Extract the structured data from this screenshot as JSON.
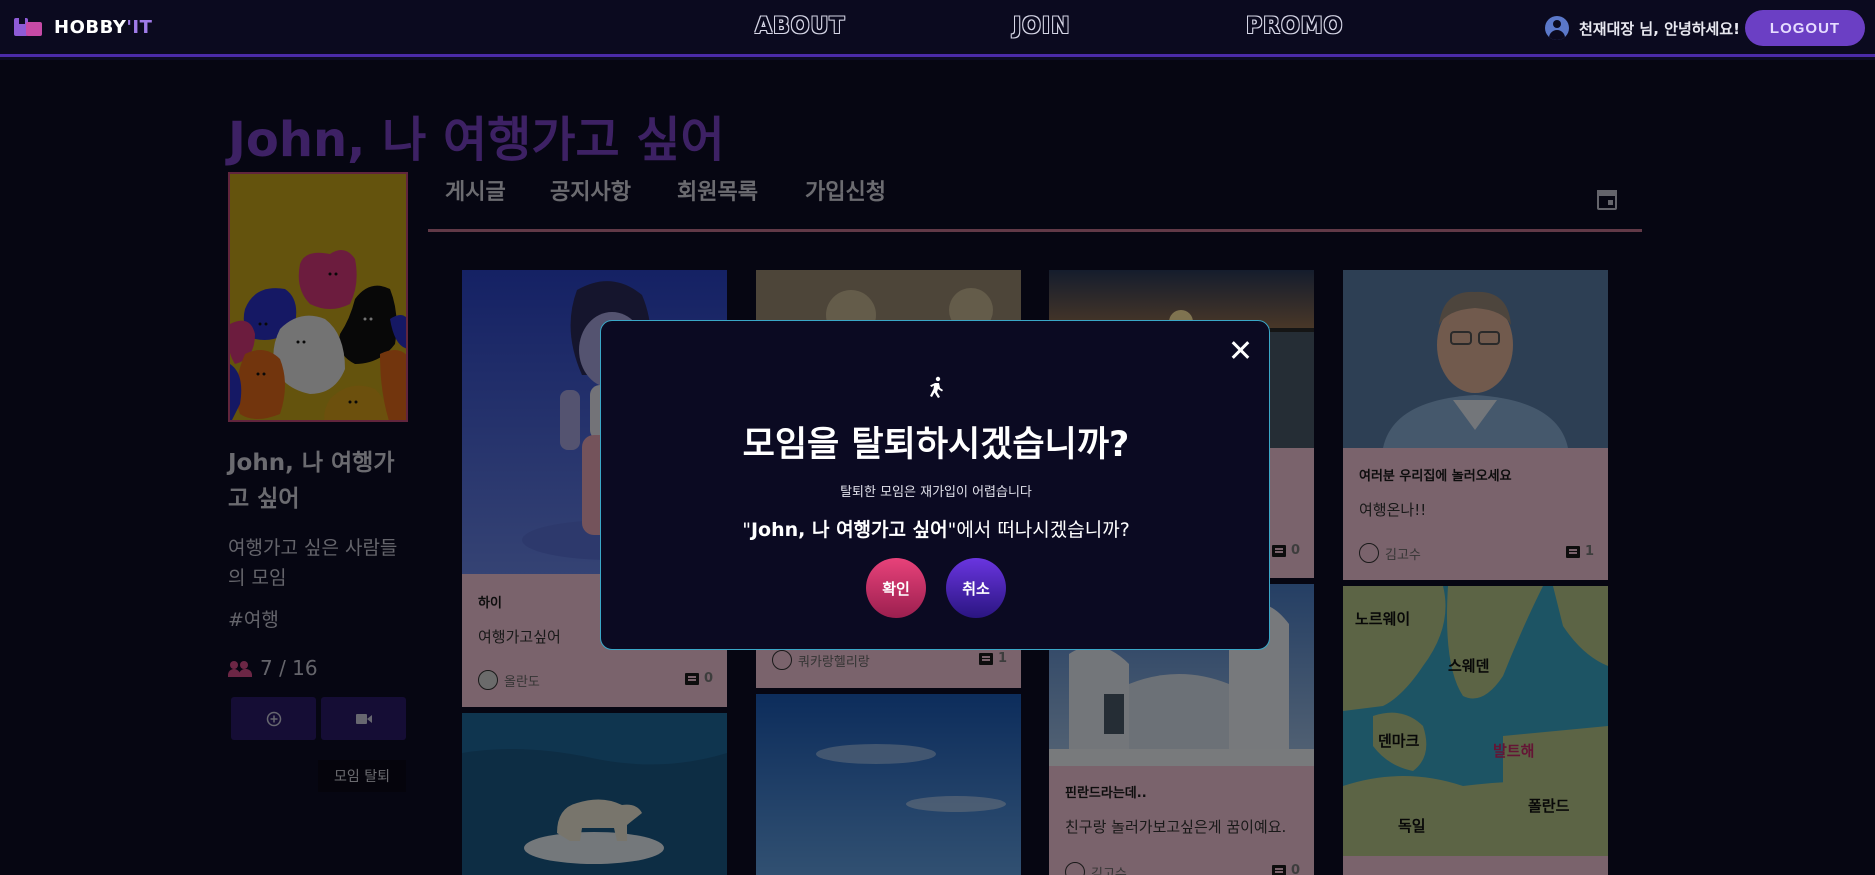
{
  "navbar": {
    "logo_text_main": "HOBBY",
    "logo_text_accent": "'IT",
    "links": [
      "ABOUT",
      "JOIN",
      "PROMO"
    ],
    "user_greeting": "천재대장 님, 안녕하세요!",
    "logout_label": "LOGOUT"
  },
  "group": {
    "title": "John, 나 여행가고 싶어",
    "side_name": "John, 나 여행가고 싶어",
    "description": "여행가고 싶은 사람들의 모임",
    "hashtag": "#여행",
    "member_count": "7 / 16",
    "leave_label": "모임 탈퇴"
  },
  "tabs": [
    "게시글",
    "공지사항",
    "회원목록",
    "가입신청"
  ],
  "cards": [
    {
      "title": "하이",
      "body": "여행가고싶어",
      "author": "올란도",
      "comments": "0"
    },
    {
      "title": "",
      "body": "",
      "author": "쿼카랑헬리랑",
      "comments": "1"
    },
    {
      "title": "",
      "body": "",
      "author": "",
      "comments": "0"
    },
    {
      "title": "여러분 우리집에 놀러오세요",
      "body": "여행온나!!",
      "author": "김고수",
      "comments": "1"
    },
    {
      "title": "핀란드라는데..",
      "body": "친구랑 놀러가보고싶은게 꿈이예요.",
      "author": "김고수",
      "comments": "0"
    }
  ],
  "map_labels": [
    "노르웨이",
    "스웨덴",
    "덴마크",
    "발트해",
    "독일",
    "폴란드"
  ],
  "modal": {
    "title": "모임을 탈퇴하시겠습니까?",
    "subtitle": "탈퇴한 모임은 재가입이 어렵습니다",
    "question_group": "John, 나 여행가고 싶어",
    "question_suffix": "에서 떠나시겠습니까?",
    "confirm_label": "확인",
    "cancel_label": "취소"
  },
  "colors": {
    "accent_purple": "#7a43c9",
    "card_pink": "#f5c6d8",
    "confirm_pink": "#e8427a",
    "cancel_purple": "#6a35e0",
    "modal_border": "#3aa8c8"
  }
}
